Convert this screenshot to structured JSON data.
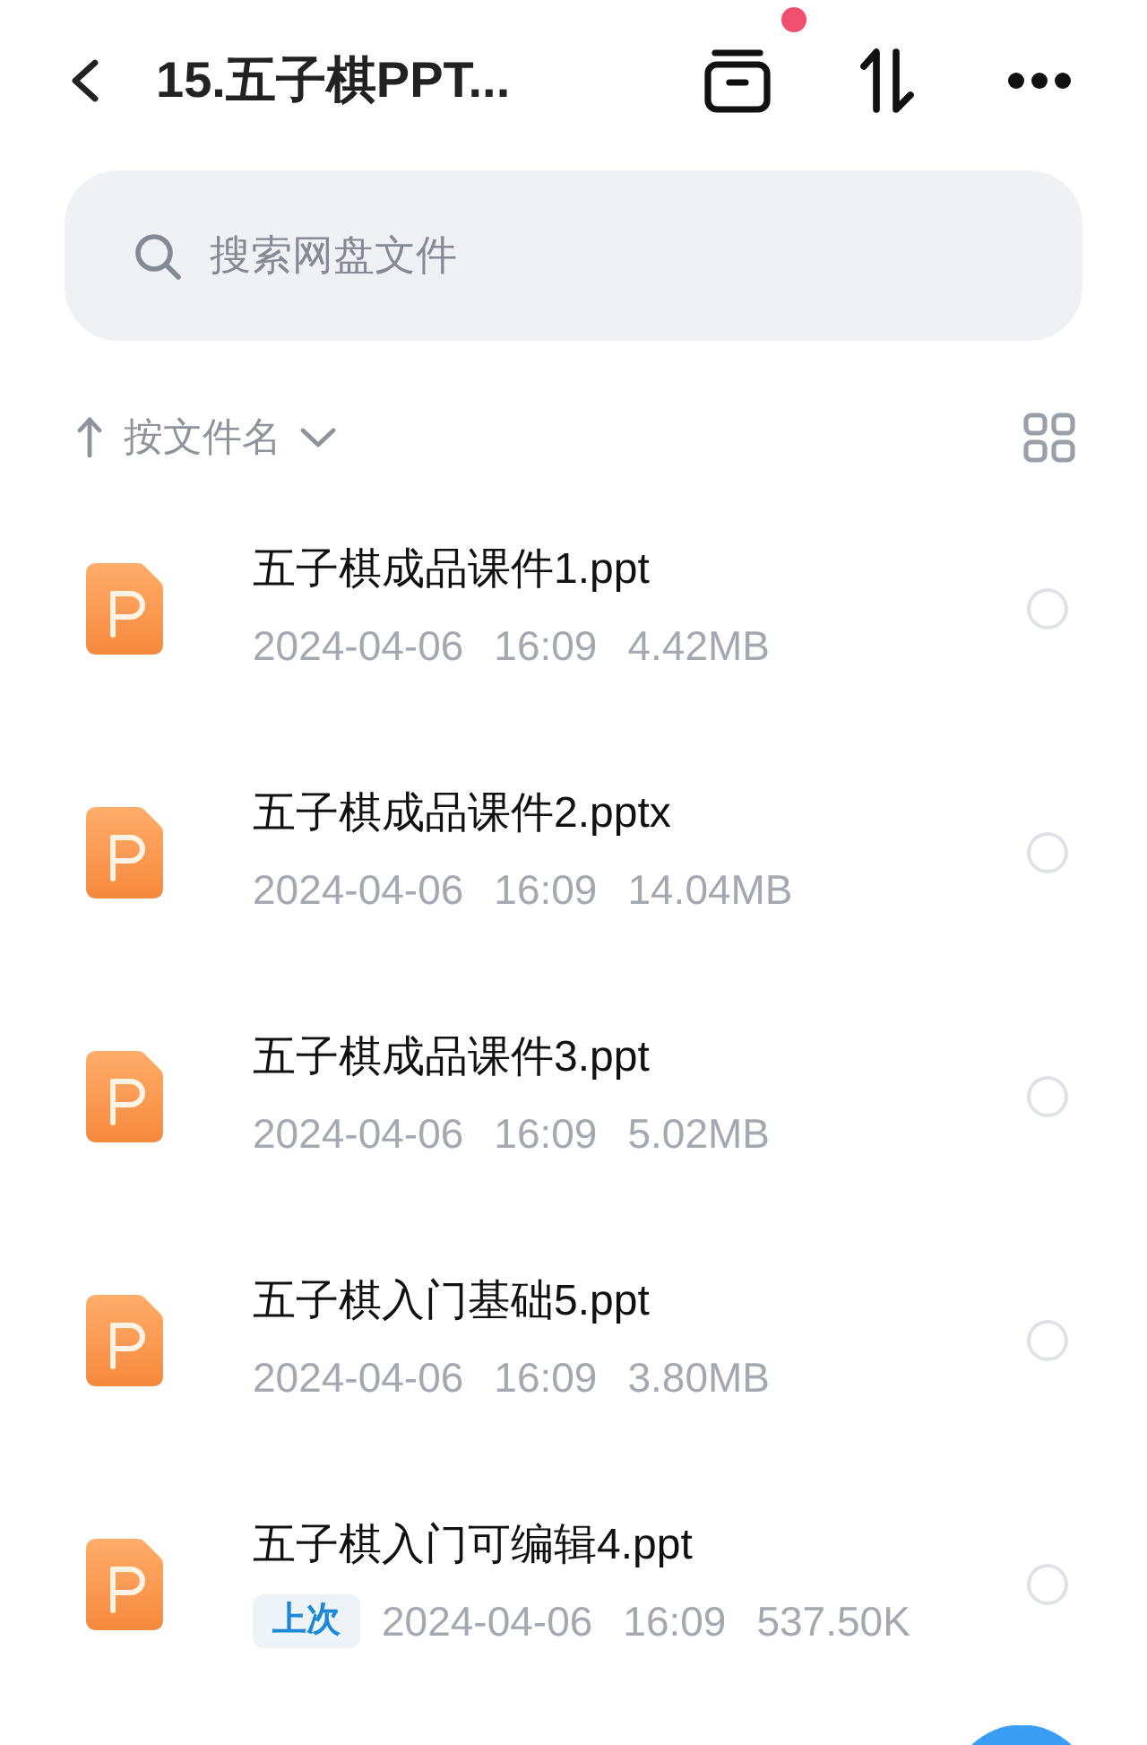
{
  "header": {
    "title": "15.五子棋PPT...",
    "notification_dot": true
  },
  "search": {
    "placeholder": "搜索网盘文件"
  },
  "sort_bar": {
    "label": "按文件名"
  },
  "files": [
    {
      "name": "五子棋成品课件1.ppt",
      "date": "2024-04-06",
      "time": "16:09",
      "size": "4.42MB",
      "selected": false
    },
    {
      "name": "五子棋成品课件2.pptx",
      "date": "2024-04-06",
      "time": "16:09",
      "size": "14.04MB",
      "selected": false
    },
    {
      "name": "五子棋成品课件3.ppt",
      "date": "2024-04-06",
      "time": "16:09",
      "size": "5.02MB",
      "selected": false
    },
    {
      "name": "五子棋入门基础5.ppt",
      "date": "2024-04-06",
      "time": "16:09",
      "size": "3.80MB",
      "selected": false
    },
    {
      "name": "五子棋入门可编辑4.ppt",
      "tag": "上次",
      "date": "2024-04-06",
      "time": "16:09",
      "size": "537.50K",
      "selected": false
    }
  ]
}
